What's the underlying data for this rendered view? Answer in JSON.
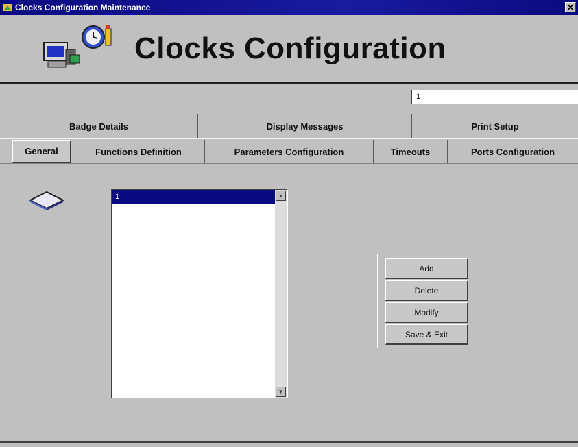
{
  "window": {
    "title": "Clocks Configuration Maintenance",
    "close_label": "✕"
  },
  "header": {
    "banner_title": "Clocks Configuration"
  },
  "record_field": {
    "value": "1"
  },
  "tabs_row1": [
    {
      "label": "Badge Details"
    },
    {
      "label": "Display Messages"
    },
    {
      "label": "Print Setup"
    }
  ],
  "tabs_row2": [
    {
      "label": "General",
      "active": true
    },
    {
      "label": "Functions Definition"
    },
    {
      "label": "Parameters Configuration"
    },
    {
      "label": "Timeouts"
    },
    {
      "label": "Ports Configuration"
    }
  ],
  "clock_list": {
    "items": [
      "1"
    ],
    "selected": "1"
  },
  "actions": {
    "add": "Add",
    "delete": "Delete",
    "modify": "Modify",
    "save_exit": "Save & Exit"
  },
  "colors": {
    "title_bar": "#0a0a80",
    "window_bg": "#c0c0c0",
    "selection": "#0a0a80"
  },
  "icons": [
    "app-icon",
    "computer-icon",
    "clock-icon",
    "diamond-icon",
    "close-icon",
    "scroll-up-icon",
    "scroll-down-icon"
  ]
}
